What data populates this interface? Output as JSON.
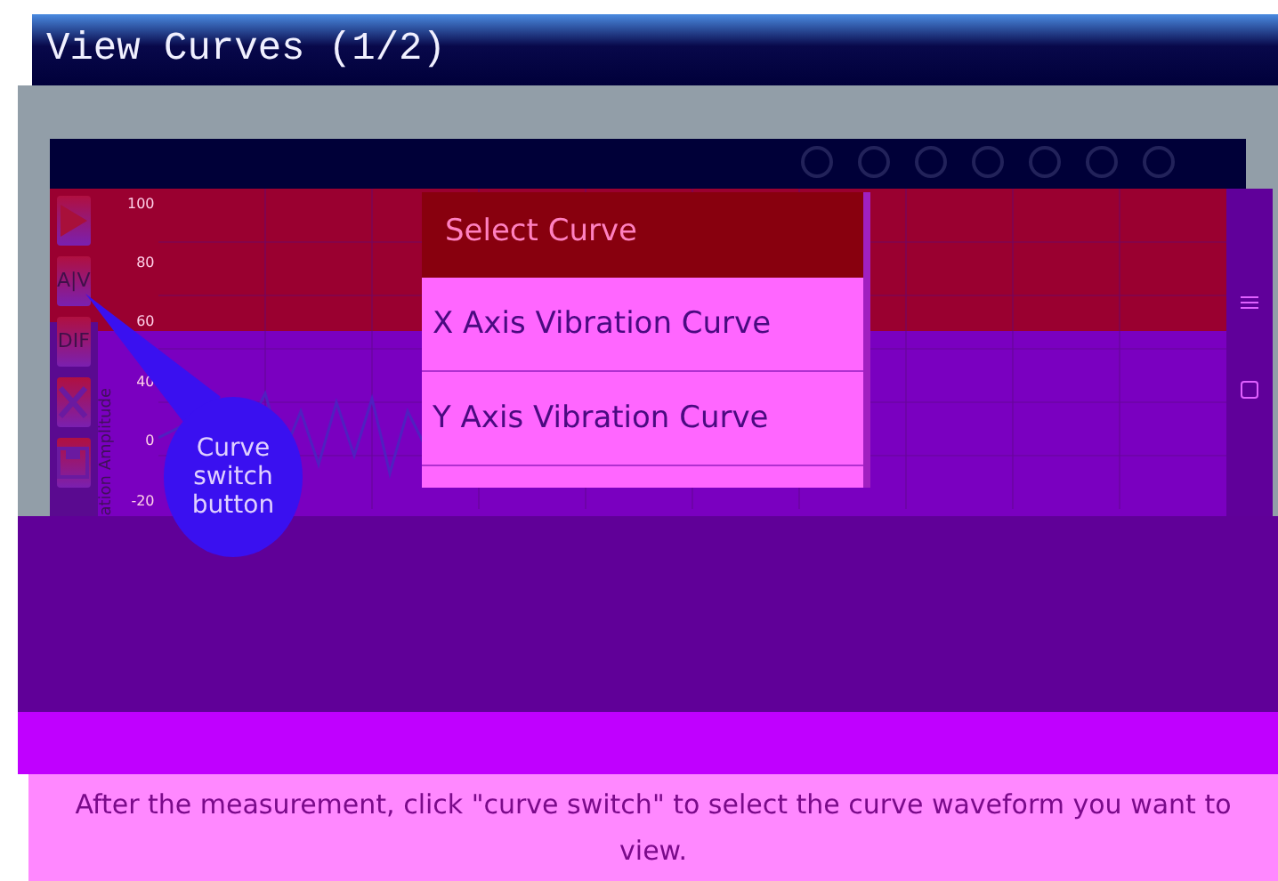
{
  "title": "View Curves (1/2)",
  "sidebar": [
    {
      "kind": "play"
    },
    {
      "kind": "text",
      "label": "A|V"
    },
    {
      "kind": "text",
      "label": "DIF"
    },
    {
      "kind": "clear"
    },
    {
      "kind": "save"
    }
  ],
  "chart": {
    "yticks": [
      "100",
      "80",
      "60",
      "40",
      "0",
      "-20"
    ],
    "ylabel": "ation Amplitude"
  },
  "popup": {
    "title": "Select Curve",
    "items": [
      {
        "label": "X Axis Vibration Curve",
        "selected": false
      },
      {
        "label": "Y Axis Vibration Curve",
        "selected": false
      }
    ]
  },
  "callout": "Curve switch button",
  "caption": "After the measurement, click \"curve switch\" to select the curve waveform you want to view."
}
